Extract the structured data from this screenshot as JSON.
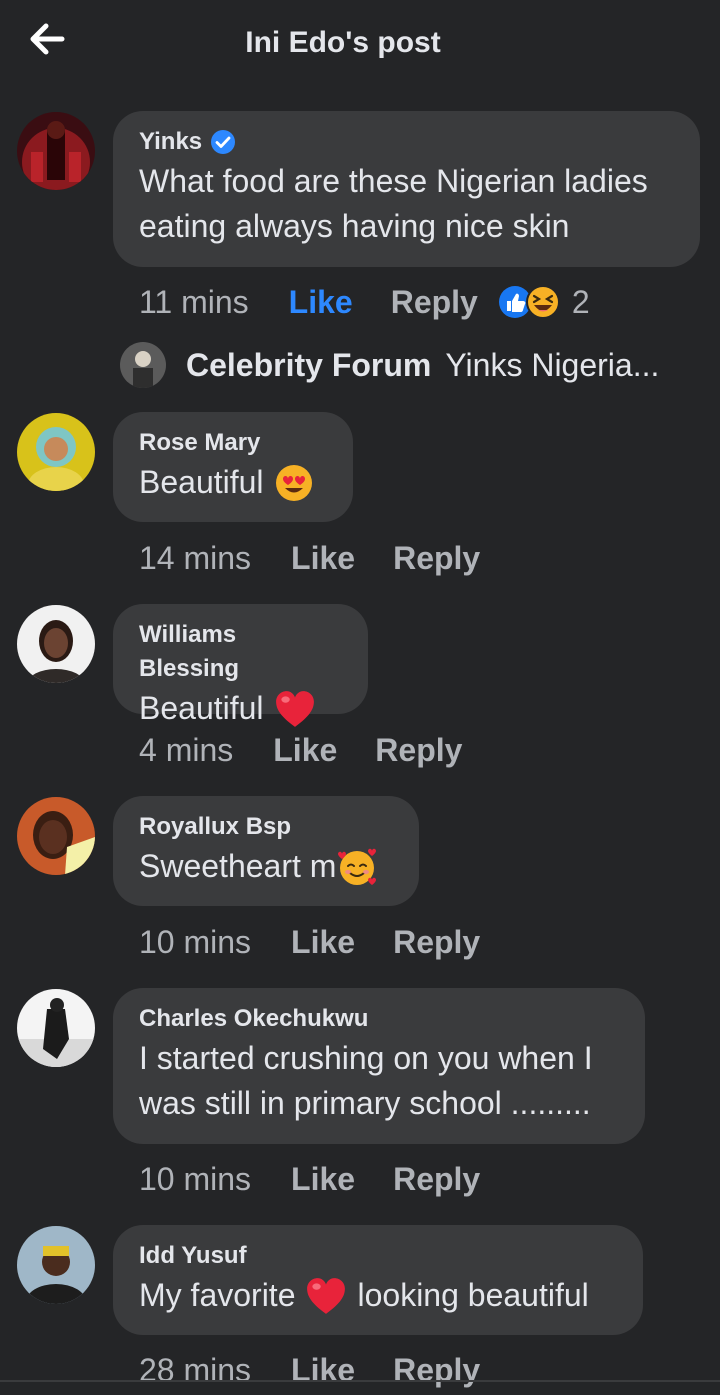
{
  "header": {
    "title": "Ini Edo's post",
    "back_icon": "arrow-left-icon"
  },
  "colors": {
    "background": "#242527",
    "bubble": "#3a3b3d",
    "accent_like": "#2d88ff",
    "verified": "#2d88ff"
  },
  "comments": [
    {
      "author": "Yinks",
      "verified": true,
      "text_line1": "What food are these Nigerian ladies",
      "text_line2": "eating always having nice skin",
      "time": "11 mins",
      "like_label": "Like",
      "liked": true,
      "reply_label": "Reply",
      "reaction_count": "2",
      "reaction_icons": [
        "like-reaction-icon",
        "haha-reaction-icon"
      ]
    },
    {
      "author": "Rose Mary",
      "text": "Beautiful",
      "emoji": "heart-eyes-emoji-icon",
      "time": "14 mins",
      "like_label": "Like",
      "reply_label": "Reply"
    },
    {
      "author": "Williams Blessing",
      "text": "Beautiful",
      "emoji": "red-heart-emoji-icon",
      "time": "4 mins",
      "like_label": "Like",
      "reply_label": "Reply"
    },
    {
      "author": "Royallux Bsp",
      "text": "Sweetheart m",
      "emoji": "smiling-hearts-emoji-icon",
      "time": "10 mins",
      "like_label": "Like",
      "reply_label": "Reply"
    },
    {
      "author": "Charles Okechukwu",
      "text_line1": "I started crushing on you when I",
      "text_line2": "was still in primary school .........",
      "time": "10 mins",
      "like_label": "Like",
      "reply_label": "Reply"
    },
    {
      "author": "Idd Yusuf",
      "text_before": "My favorite",
      "text_after": "looking beautiful",
      "emoji": "red-heart-emoji-icon",
      "time": "28 mins",
      "like_label": "Like",
      "reply_label": "Reply"
    }
  ],
  "reply_preview": {
    "author": "Celebrity Forum",
    "text": "Yinks Nigeria..."
  }
}
